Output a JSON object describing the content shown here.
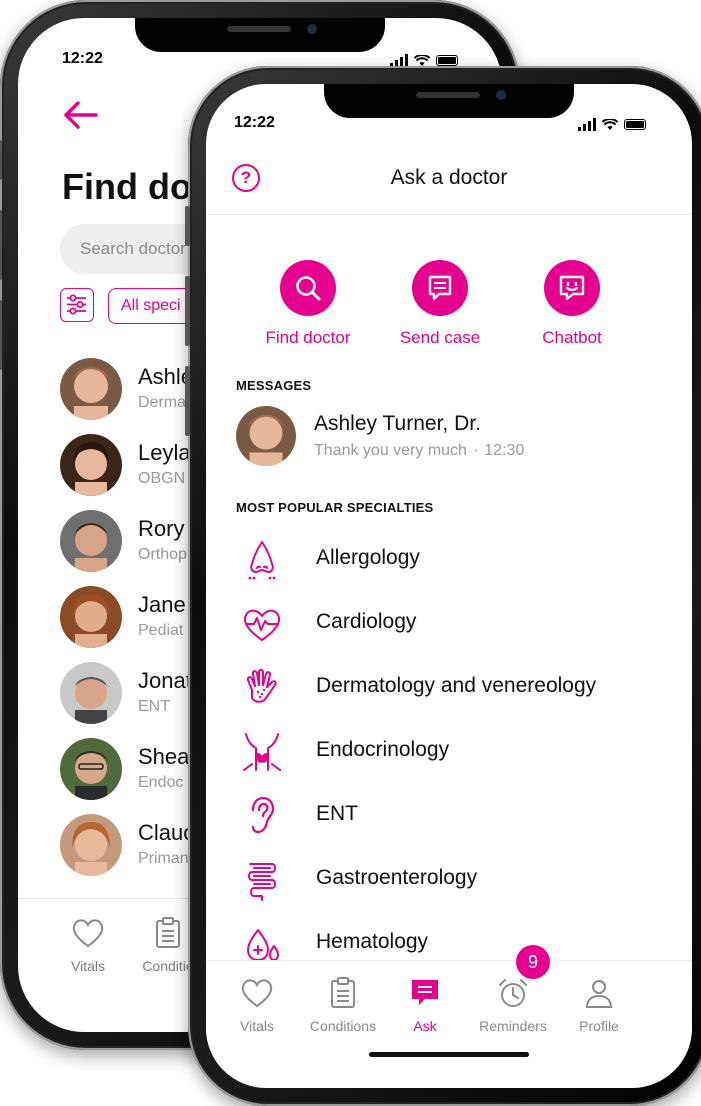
{
  "back_screen": {
    "time": "12:22",
    "title": "Find do",
    "search_placeholder": "Search doctor",
    "filter_chip": "All speci",
    "doctors": [
      {
        "name": "Ashle",
        "specialty": "Derma"
      },
      {
        "name": "Leyla",
        "specialty": "OBGN"
      },
      {
        "name": "Rory",
        "specialty": "Orthop"
      },
      {
        "name": "Jane",
        "specialty": "Pediat"
      },
      {
        "name": "Jonat",
        "specialty": "ENT"
      },
      {
        "name": "Shea",
        "specialty": "Endoc"
      },
      {
        "name": "Clauc",
        "specialty": "Priman"
      }
    ],
    "tabs": [
      {
        "label": "Vitals",
        "icon": "heart-icon"
      },
      {
        "label": "Conditio",
        "icon": "clipboard-icon"
      }
    ]
  },
  "front_screen": {
    "time": "12:22",
    "title": "Ask a doctor",
    "help_icon": "?",
    "actions": [
      {
        "label": "Find doctor",
        "icon": "search-icon"
      },
      {
        "label": "Send case",
        "icon": "message-icon"
      },
      {
        "label": "Chatbot",
        "icon": "chatbot-icon"
      }
    ],
    "messages_heading": "MESSAGES",
    "message": {
      "name": "Ashley Turner, Dr.",
      "preview": "Thank you very much",
      "separator": "·",
      "time": "12:30"
    },
    "specialties_heading": "MOST POPULAR SPECIALTIES",
    "specialties": [
      {
        "label": "Allergology",
        "icon": "nose-icon"
      },
      {
        "label": "Cardiology",
        "icon": "heart-pulse-icon"
      },
      {
        "label": "Dermatology and venereology",
        "icon": "hand-icon"
      },
      {
        "label": "Endocrinology",
        "icon": "thyroid-icon"
      },
      {
        "label": "ENT",
        "icon": "ear-icon"
      },
      {
        "label": "Gastroenterology",
        "icon": "intestine-icon"
      },
      {
        "label": "Hematology",
        "icon": "blood-drop-icon"
      }
    ],
    "tabs": [
      {
        "label": "Vitals",
        "icon": "heart-icon",
        "active": false
      },
      {
        "label": "Conditions",
        "icon": "clipboard-icon",
        "active": false
      },
      {
        "label": "Ask",
        "icon": "chat-icon",
        "active": true
      },
      {
        "label": "Reminders",
        "icon": "alarm-clock-icon",
        "active": false
      },
      {
        "label": "Profile",
        "icon": "person-icon",
        "active": false
      }
    ],
    "reminders_badge": "9"
  },
  "colors": {
    "accent": "#e5008f",
    "muted_text": "#9a9a9a",
    "text": "#111111"
  }
}
